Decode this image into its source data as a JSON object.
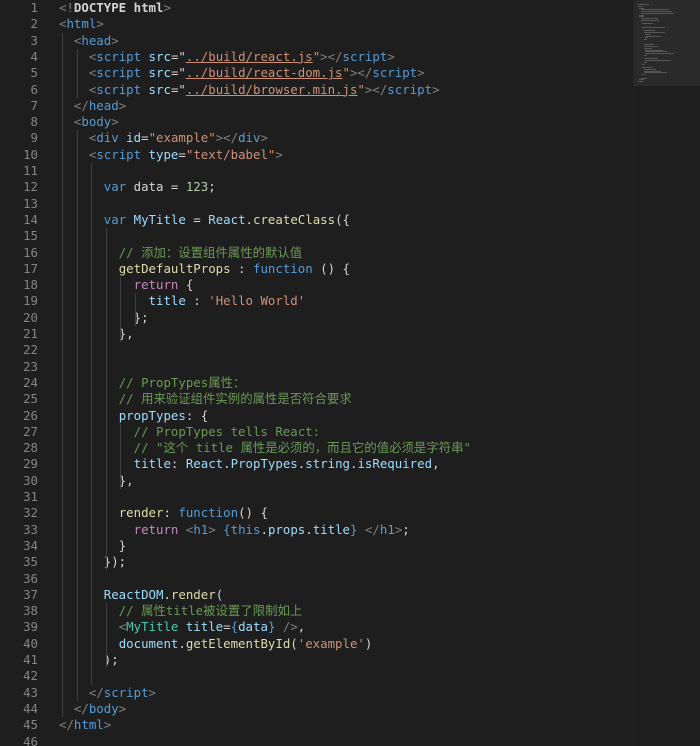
{
  "editor": {
    "lines": [
      [
        {
          "t": "<!",
          "c": "punct"
        },
        {
          "t": "DOCTYPE ",
          "c": "plain"
        },
        {
          "t": "html",
          "c": "plain"
        },
        {
          "t": ">",
          "c": "punct"
        }
      ],
      [
        {
          "t": "<",
          "c": "punct"
        },
        {
          "t": "html",
          "c": "tag"
        },
        {
          "t": ">",
          "c": "punct"
        }
      ],
      [
        {
          "t": "  ",
          "c": "plain"
        },
        {
          "t": "<",
          "c": "punct"
        },
        {
          "t": "head",
          "c": "tag"
        },
        {
          "t": ">",
          "c": "punct"
        }
      ],
      [
        {
          "t": "    ",
          "c": "plain"
        },
        {
          "t": "<",
          "c": "punct"
        },
        {
          "t": "script",
          "c": "tag"
        },
        {
          "t": " ",
          "c": "plain"
        },
        {
          "t": "src",
          "c": "attr"
        },
        {
          "t": "=\"",
          "c": "plain"
        },
        {
          "t": "../build/react.js",
          "c": "link"
        },
        {
          "t": "\"",
          "c": "str"
        },
        {
          "t": "></",
          "c": "punct"
        },
        {
          "t": "script",
          "c": "tag"
        },
        {
          "t": ">",
          "c": "punct"
        }
      ],
      [
        {
          "t": "    ",
          "c": "plain"
        },
        {
          "t": "<",
          "c": "punct"
        },
        {
          "t": "script",
          "c": "tag"
        },
        {
          "t": " ",
          "c": "plain"
        },
        {
          "t": "src",
          "c": "attr"
        },
        {
          "t": "=\"",
          "c": "plain"
        },
        {
          "t": "../build/react-dom.js",
          "c": "link"
        },
        {
          "t": "\"",
          "c": "str"
        },
        {
          "t": "></",
          "c": "punct"
        },
        {
          "t": "script",
          "c": "tag"
        },
        {
          "t": ">",
          "c": "punct"
        }
      ],
      [
        {
          "t": "    ",
          "c": "plain"
        },
        {
          "t": "<",
          "c": "punct"
        },
        {
          "t": "script",
          "c": "tag"
        },
        {
          "t": " ",
          "c": "plain"
        },
        {
          "t": "src",
          "c": "attr"
        },
        {
          "t": "=\"",
          "c": "plain"
        },
        {
          "t": "../build/browser.min.js",
          "c": "link"
        },
        {
          "t": "\"",
          "c": "str"
        },
        {
          "t": "></",
          "c": "punct"
        },
        {
          "t": "script",
          "c": "tag"
        },
        {
          "t": ">",
          "c": "punct"
        }
      ],
      [
        {
          "t": "  ",
          "c": "plain"
        },
        {
          "t": "</",
          "c": "punct"
        },
        {
          "t": "head",
          "c": "tag"
        },
        {
          "t": ">",
          "c": "punct"
        }
      ],
      [
        {
          "t": "  ",
          "c": "plain"
        },
        {
          "t": "<",
          "c": "punct"
        },
        {
          "t": "body",
          "c": "tag"
        },
        {
          "t": ">",
          "c": "punct"
        }
      ],
      [
        {
          "t": "    ",
          "c": "plain"
        },
        {
          "t": "<",
          "c": "punct"
        },
        {
          "t": "div",
          "c": "tag"
        },
        {
          "t": " ",
          "c": "plain"
        },
        {
          "t": "id",
          "c": "attr"
        },
        {
          "t": "=",
          "c": "plain"
        },
        {
          "t": "\"example\"",
          "c": "str"
        },
        {
          "t": "></",
          "c": "punct"
        },
        {
          "t": "div",
          "c": "tag"
        },
        {
          "t": ">",
          "c": "punct"
        }
      ],
      [
        {
          "t": "    ",
          "c": "plain"
        },
        {
          "t": "<",
          "c": "punct"
        },
        {
          "t": "script",
          "c": "tag"
        },
        {
          "t": " ",
          "c": "plain"
        },
        {
          "t": "type",
          "c": "attr"
        },
        {
          "t": "=",
          "c": "plain"
        },
        {
          "t": "\"text/babel\"",
          "c": "str"
        },
        {
          "t": ">",
          "c": "punct"
        }
      ],
      [],
      [
        {
          "t": "      ",
          "c": "plain"
        },
        {
          "t": "var",
          "c": "kw"
        },
        {
          "t": " data = ",
          "c": "plain"
        },
        {
          "t": "123",
          "c": "num"
        },
        {
          "t": ";",
          "c": "plain"
        }
      ],
      [],
      [
        {
          "t": "      ",
          "c": "plain"
        },
        {
          "t": "var",
          "c": "kw"
        },
        {
          "t": " ",
          "c": "plain"
        },
        {
          "t": "MyTitle",
          "c": "var"
        },
        {
          "t": " = ",
          "c": "plain"
        },
        {
          "t": "React",
          "c": "var"
        },
        {
          "t": ".",
          "c": "plain"
        },
        {
          "t": "createClass",
          "c": "fn"
        },
        {
          "t": "({",
          "c": "plain"
        }
      ],
      [],
      [
        {
          "t": "        ",
          "c": "plain"
        },
        {
          "t": "// 添加：设置组件属性的默认值",
          "c": "cmt"
        }
      ],
      [
        {
          "t": "        ",
          "c": "plain"
        },
        {
          "t": "getDefaultProps",
          "c": "fn"
        },
        {
          "t": " : ",
          "c": "plain"
        },
        {
          "t": "function",
          "c": "kw"
        },
        {
          "t": " () {",
          "c": "plain"
        }
      ],
      [
        {
          "t": "          ",
          "c": "plain"
        },
        {
          "t": "return",
          "c": "ctrl"
        },
        {
          "t": " {",
          "c": "plain"
        }
      ],
      [
        {
          "t": "            ",
          "c": "plain"
        },
        {
          "t": "title",
          "c": "var"
        },
        {
          "t": " : ",
          "c": "plain"
        },
        {
          "t": "'Hello World'",
          "c": "str"
        }
      ],
      [
        {
          "t": "          ",
          "c": "plain"
        },
        {
          "t": "};",
          "c": "plain"
        }
      ],
      [
        {
          "t": "        ",
          "c": "plain"
        },
        {
          "t": "},",
          "c": "plain"
        }
      ],
      [],
      [],
      [
        {
          "t": "        ",
          "c": "plain"
        },
        {
          "t": "// PropTypes属性：",
          "c": "cmt"
        }
      ],
      [
        {
          "t": "        ",
          "c": "plain"
        },
        {
          "t": "// 用来验证组件实例的属性是否符合要求",
          "c": "cmt"
        }
      ],
      [
        {
          "t": "        ",
          "c": "plain"
        },
        {
          "t": "propTypes",
          "c": "var"
        },
        {
          "t": ": {",
          "c": "plain"
        }
      ],
      [
        {
          "t": "          ",
          "c": "plain"
        },
        {
          "t": "// PropTypes tells React:",
          "c": "cmt"
        }
      ],
      [
        {
          "t": "          ",
          "c": "plain"
        },
        {
          "t": "// \"这个 title 属性是必须的，而且它的值必须是字符串\"",
          "c": "cmt"
        }
      ],
      [
        {
          "t": "          ",
          "c": "plain"
        },
        {
          "t": "title",
          "c": "var"
        },
        {
          "t": ": ",
          "c": "plain"
        },
        {
          "t": "React",
          "c": "var"
        },
        {
          "t": ".",
          "c": "plain"
        },
        {
          "t": "PropTypes",
          "c": "var"
        },
        {
          "t": ".",
          "c": "plain"
        },
        {
          "t": "string",
          "c": "var"
        },
        {
          "t": ".",
          "c": "plain"
        },
        {
          "t": "isRequired",
          "c": "var"
        },
        {
          "t": ",",
          "c": "plain"
        }
      ],
      [
        {
          "t": "        ",
          "c": "plain"
        },
        {
          "t": "},",
          "c": "plain"
        }
      ],
      [],
      [
        {
          "t": "        ",
          "c": "plain"
        },
        {
          "t": "render",
          "c": "fn"
        },
        {
          "t": ": ",
          "c": "plain"
        },
        {
          "t": "function",
          "c": "kw"
        },
        {
          "t": "() {",
          "c": "plain"
        }
      ],
      [
        {
          "t": "          ",
          "c": "plain"
        },
        {
          "t": "return",
          "c": "ctrl"
        },
        {
          "t": " ",
          "c": "plain"
        },
        {
          "t": "<",
          "c": "punct"
        },
        {
          "t": "h1",
          "c": "tag"
        },
        {
          "t": ">",
          "c": "punct"
        },
        {
          "t": " {",
          "c": "kw"
        },
        {
          "t": "this",
          "c": "kw"
        },
        {
          "t": ".",
          "c": "plain"
        },
        {
          "t": "props",
          "c": "var"
        },
        {
          "t": ".",
          "c": "plain"
        },
        {
          "t": "title",
          "c": "var"
        },
        {
          "t": "}",
          "c": "kw"
        },
        {
          "t": " ",
          "c": "plain"
        },
        {
          "t": "</",
          "c": "punct"
        },
        {
          "t": "h1",
          "c": "tag"
        },
        {
          "t": ">",
          "c": "punct"
        },
        {
          "t": ";",
          "c": "plain"
        }
      ],
      [
        {
          "t": "        ",
          "c": "plain"
        },
        {
          "t": "}",
          "c": "plain"
        }
      ],
      [
        {
          "t": "      ",
          "c": "plain"
        },
        {
          "t": "});",
          "c": "plain"
        }
      ],
      [],
      [
        {
          "t": "      ",
          "c": "plain"
        },
        {
          "t": "ReactDOM",
          "c": "var"
        },
        {
          "t": ".",
          "c": "plain"
        },
        {
          "t": "render",
          "c": "fn"
        },
        {
          "t": "(",
          "c": "plain"
        }
      ],
      [
        {
          "t": "        ",
          "c": "plain"
        },
        {
          "t": "// 属性title被设置了限制如上",
          "c": "cmt"
        }
      ],
      [
        {
          "t": "        ",
          "c": "plain"
        },
        {
          "t": "<",
          "c": "punct"
        },
        {
          "t": "MyTitle",
          "c": "type"
        },
        {
          "t": " ",
          "c": "plain"
        },
        {
          "t": "title",
          "c": "attr"
        },
        {
          "t": "=",
          "c": "plain"
        },
        {
          "t": "{",
          "c": "kw"
        },
        {
          "t": "data",
          "c": "var"
        },
        {
          "t": "}",
          "c": "kw"
        },
        {
          "t": " />",
          "c": "punct"
        },
        {
          "t": ",",
          "c": "plain"
        }
      ],
      [
        {
          "t": "        ",
          "c": "plain"
        },
        {
          "t": "document",
          "c": "var"
        },
        {
          "t": ".",
          "c": "plain"
        },
        {
          "t": "getElementById",
          "c": "fn"
        },
        {
          "t": "(",
          "c": "plain"
        },
        {
          "t": "'example'",
          "c": "str"
        },
        {
          "t": ")",
          "c": "plain"
        }
      ],
      [
        {
          "t": "      ",
          "c": "plain"
        },
        {
          "t": ");",
          "c": "plain"
        }
      ],
      [],
      [
        {
          "t": "    ",
          "c": "plain"
        },
        {
          "t": "</",
          "c": "punct"
        },
        {
          "t": "script",
          "c": "tag"
        },
        {
          "t": ">",
          "c": "punct"
        }
      ],
      [
        {
          "t": "  ",
          "c": "plain"
        },
        {
          "t": "</",
          "c": "punct"
        },
        {
          "t": "body",
          "c": "tag"
        },
        {
          "t": ">",
          "c": "punct"
        }
      ],
      [
        {
          "t": "</",
          "c": "punct"
        },
        {
          "t": "html",
          "c": "tag"
        },
        {
          "t": ">",
          "c": "punct"
        }
      ],
      []
    ]
  },
  "colors": {
    "background": "#1e1e1e",
    "line_number": "#858585",
    "tag": "#569cd6",
    "attribute": "#9cdcfe",
    "string": "#ce9178",
    "comment": "#6a9955",
    "function": "#dcdcaa",
    "control": "#c586c0",
    "number": "#b5cea8",
    "type": "#4ec9b0"
  }
}
